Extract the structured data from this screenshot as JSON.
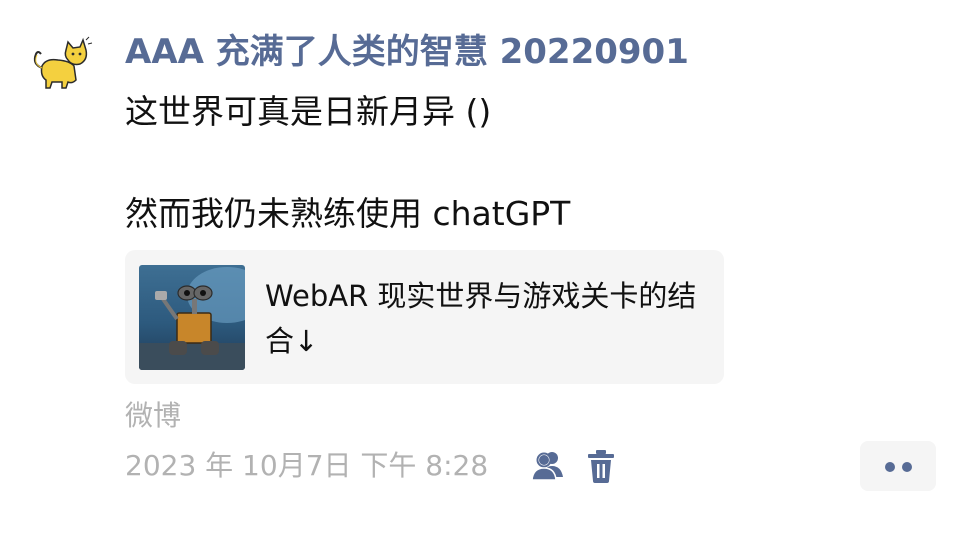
{
  "post": {
    "username": "AAA 充满了人类的智慧 20220901",
    "text_line1": "这世界可真是日新月异 ()",
    "text_line2": "然而我仍未熟练使用 chatGPT",
    "avatar_icon": "yellow-cat-avatar"
  },
  "link_card": {
    "title": "WebAR 现实世界与游戏关卡的结合↓",
    "thumbnail_icon": "robot-thumbnail"
  },
  "meta": {
    "source": "微博",
    "timestamp": "2023 年 10月7日 下午 8:28",
    "visibility_icon": "people-icon",
    "delete_icon": "trash-icon",
    "more_icon": "more-dots-icon"
  },
  "colors": {
    "link_blue": "#576b95",
    "meta_gray": "#b2b2b2",
    "card_bg": "#f5f5f5",
    "text": "#111111"
  }
}
